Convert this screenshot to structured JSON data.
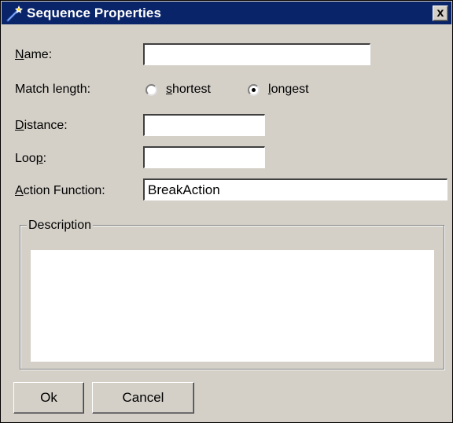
{
  "window": {
    "title": "Sequence Properties",
    "close_label": "x"
  },
  "name": {
    "label_prefix": "",
    "label_mnemonic": "N",
    "label_rest": "ame:",
    "value": ""
  },
  "match_length": {
    "label": "Match length:",
    "options": [
      {
        "mnemonic": "s",
        "rest": "hortest",
        "selected": false
      },
      {
        "mnemonic": "l",
        "rest": "ongest",
        "selected": true
      }
    ]
  },
  "distance": {
    "label_mnemonic": "D",
    "label_rest": "istance:",
    "value": ""
  },
  "loop": {
    "label_prefix": "Loo",
    "label_mnemonic": "p",
    "label_rest": ":",
    "value": ""
  },
  "action_function": {
    "label_mnemonic": "A",
    "label_rest": "ction Function:",
    "value": "BreakAction"
  },
  "description": {
    "legend": "Description",
    "value": ""
  },
  "buttons": {
    "ok": "Ok",
    "cancel": "Cancel"
  },
  "colors": {
    "titlebar": "#0a246a",
    "face": "#d4d0c8"
  },
  "icons": {
    "title": "wand-icon",
    "close": "close-icon"
  }
}
